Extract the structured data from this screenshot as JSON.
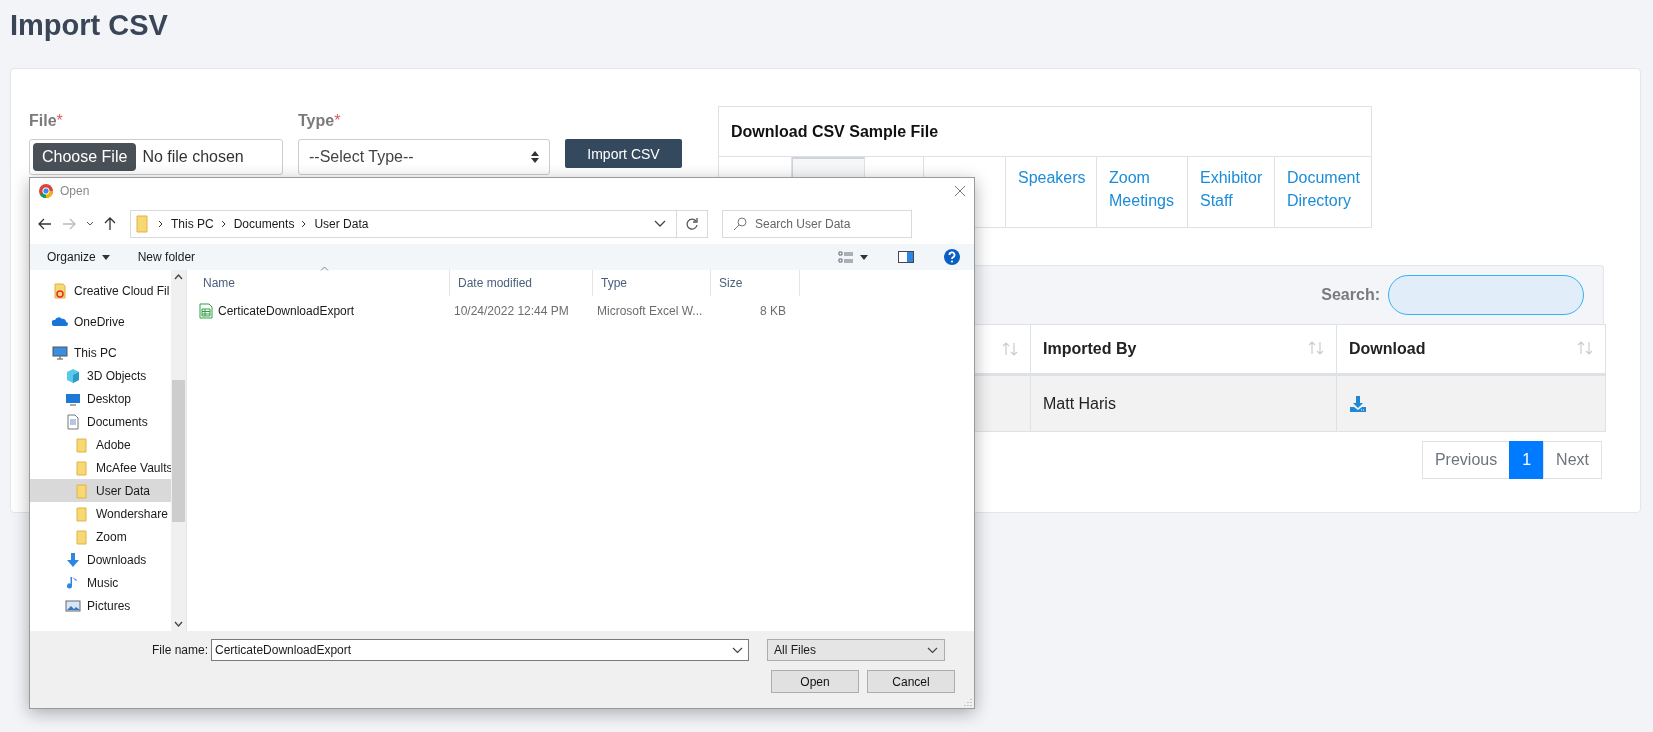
{
  "page": {
    "title": "Import CSV"
  },
  "form": {
    "file_label": "File",
    "file_required": "*",
    "choose_button": "Choose File",
    "file_status": "No file chosen",
    "type_label": "Type",
    "type_required": "*",
    "type_select": "--Select Type--",
    "import_button": "Import CSV"
  },
  "sample_files": {
    "title": "Download CSV Sample File",
    "tabs": [
      {
        "selected": false
      },
      {
        "selected": true
      },
      {
        "selected": false
      },
      {
        "selected": false
      },
      {
        "label": "Speakers",
        "selected": false
      },
      {
        "label": "Zoom Meetings",
        "selected": false
      },
      {
        "label": "Exhibitor Staff",
        "selected": false
      },
      {
        "label": "Document Directory",
        "selected": false
      }
    ]
  },
  "table": {
    "search_label": "Search:",
    "columns": [
      {
        "label": "Imported By"
      },
      {
        "label": "Download"
      }
    ],
    "rows": [
      {
        "imported_by": "Matt Haris"
      }
    ],
    "pagination": {
      "previous": "Previous",
      "pages": [
        {
          "label": "1",
          "selected": true
        }
      ],
      "next": "Next"
    }
  },
  "dialog": {
    "title": "Open",
    "path": [
      "This PC",
      "Documents",
      "User Data"
    ],
    "search_placeholder": "Search User Data",
    "organize": "Organize",
    "new_folder": "New folder",
    "nav": [
      {
        "label": "Creative Cloud Fil",
        "kind": "cloud-files",
        "selected": false
      },
      {
        "label": "OneDrive",
        "kind": "onedrive",
        "selected": false
      },
      {
        "label": "This PC",
        "kind": "pc",
        "selected": false,
        "children": [
          {
            "label": "3D Objects",
            "kind": "objects3d",
            "selected": false
          },
          {
            "label": "Desktop",
            "kind": "desktop",
            "selected": false
          },
          {
            "label": "Documents",
            "kind": "documents",
            "selected": false,
            "children": [
              {
                "label": "Adobe",
                "kind": "folder",
                "selected": false
              },
              {
                "label": "McAfee Vaults",
                "kind": "folder",
                "selected": false
              },
              {
                "label": "User Data",
                "kind": "folder",
                "selected": true
              },
              {
                "label": "Wondershare",
                "kind": "folder",
                "selected": false
              },
              {
                "label": "Zoom",
                "kind": "folder",
                "selected": false
              }
            ]
          },
          {
            "label": "Downloads",
            "kind": "downloads",
            "selected": false
          },
          {
            "label": "Music",
            "kind": "music",
            "selected": false
          },
          {
            "label": "Pictures",
            "kind": "pictures",
            "selected": false
          }
        ]
      }
    ],
    "columns": [
      "Name",
      "Date modified",
      "Type",
      "Size"
    ],
    "files": [
      {
        "name": "CerticateDownloadExport",
        "date": "10/24/2022 12:44 PM",
        "type": "Microsoft Excel W...",
        "size": "8 KB"
      }
    ],
    "file_name_label": "File name:",
    "file_name": "CerticateDownloadExport",
    "file_type": "All Files",
    "open_button": "Open",
    "cancel_button": "Cancel"
  }
}
